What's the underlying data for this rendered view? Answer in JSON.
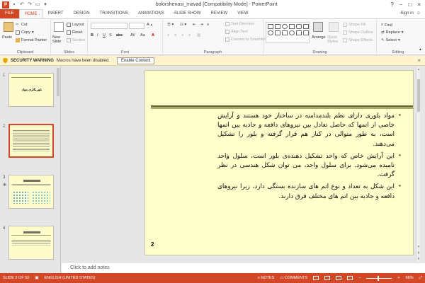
{
  "window": {
    "title": "bolorshenasi_mavad [Compatibility Mode] - PowerPoint",
    "controls": [
      "?",
      "−",
      "□",
      "×"
    ]
  },
  "tabs": [
    {
      "label": "FILE",
      "kind": "file"
    },
    {
      "label": "HOME",
      "kind": "active"
    },
    {
      "label": "INSERT",
      "kind": ""
    },
    {
      "label": "DESIGN",
      "kind": ""
    },
    {
      "label": "TRANSITIONS",
      "kind": ""
    },
    {
      "label": "ANIMATIONS",
      "kind": ""
    },
    {
      "label": "SLIDE SHOW",
      "kind": ""
    },
    {
      "label": "REVIEW",
      "kind": ""
    },
    {
      "label": "VIEW",
      "kind": ""
    }
  ],
  "signin": "Sign in",
  "ribbon": {
    "clipboard": {
      "label": "Clipboard",
      "paste": "Paste",
      "cut": "Cut",
      "copy": "Copy",
      "format_painter": "Format Painter"
    },
    "slides": {
      "label": "Slides",
      "new_slide": "New Slide",
      "layout": "Layout",
      "reset": "Reset",
      "section": "Section"
    },
    "font": {
      "label": "Font"
    },
    "paragraph": {
      "label": "Paragraph",
      "text_direction": "Text Direction",
      "align_text": "Align Text",
      "smartart": "Convert to SmartArt"
    },
    "drawing": {
      "label": "Drawing",
      "arrange": "Arrange",
      "quick_styles": "Quick Styles",
      "shape_fill": "Shape Fill",
      "shape_outline": "Shape Outline",
      "shape_effects": "Shape Effects"
    },
    "editing": {
      "label": "Editing",
      "find": "Find",
      "replace": "Replace",
      "select": "Select"
    }
  },
  "security_bar": {
    "title": "SECURITY WARNING",
    "message": "Macros have been disabled.",
    "button": "Enable Content"
  },
  "thumbnails": [
    {
      "num": "1",
      "title": "بلورنگاری مواد"
    },
    {
      "num": "2"
    },
    {
      "num": "3"
    },
    {
      "num": "4"
    }
  ],
  "slide": {
    "bullets": [
      "مواد بلوری دارای نظم بلندمدامنه در ساختار خود هستند و آرایش خاصی از اتمها که حاصل تعادل بین نیروهای دافعه و جاذبه بین اتمها است، به طور متوالی در کنار هم قرار گرفته و بلور را تشکیل می‌دهند.",
      "این آرایش خاص که واحد تشکیل دهنده‌ی بلور است، سلول واحد نامیده می‌شود. برای سلول واحد، می توان شکل هندسی در نظر گرفت.",
      "این شکل به تعداد و نوع اتم های سازنده بستگی دارد، زیرا نیروهای دافعه و جاذبه بین اتم های مختلف فرق دارند."
    ],
    "number": "2"
  },
  "notes_placeholder": "Click to add notes",
  "status": {
    "slide_info": "SLIDE 2 OF 50",
    "language": "ENGLISH (UNITED STATES)",
    "notes": "NOTES",
    "comments": "COMMENTS",
    "zoom": "66%"
  }
}
